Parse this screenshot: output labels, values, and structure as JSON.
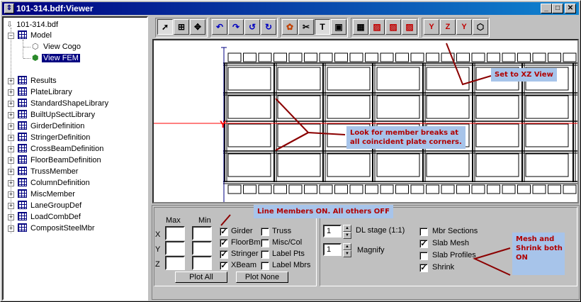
{
  "window": {
    "title": "101-314.bdf:Viewer",
    "controls": {
      "minimize": "_",
      "maximize": "□",
      "close": "✕"
    }
  },
  "tree": {
    "root": "101-314.bdf",
    "model": "Model",
    "model_children": [
      "View Cogo",
      "View FEM"
    ],
    "selected": "View FEM",
    "items": [
      "Results",
      "PlateLibrary",
      "StandardShapeLibrary",
      "BuiltUpSectLibrary",
      "GirderDefinition",
      "StringerDefinition",
      "CrossBeamDefinition",
      "FloorBeamDefinition",
      "TrussMember",
      "ColumnDefinition",
      "MiscMember",
      "LaneGroupDef",
      "LoadCombDef",
      "CompositSteelMbr"
    ]
  },
  "toolbar": {
    "groups": [
      [
        "pointer-tool",
        "zoom-window-tool",
        "pan-tool"
      ],
      [
        "rotate-x-tool",
        "rotate-y-tool",
        "rotate-z-tool",
        "rotate-free-tool"
      ],
      [
        "color-tool",
        "pin-tool",
        "text-tool",
        "render-tool"
      ],
      [
        "grid-tool",
        "view-xy-tool",
        "view-yz-tool",
        "view-xz-tool"
      ],
      [
        "axis-yx-tool",
        "axis-zx-tool",
        "axis-yz-tool",
        "iso-tool"
      ]
    ],
    "text_tool_label": "T",
    "axis_labels": [
      "Y",
      "Z",
      "Y"
    ]
  },
  "canvas": {
    "axis_label": "Y",
    "callouts": {
      "xz_view": "Set to XZ View",
      "member_breaks": "Look for member breaks at\nall coincident plate corners."
    }
  },
  "panel": {
    "range": {
      "max_label": "Max",
      "min_label": "Min",
      "axes": [
        "X",
        "Y",
        "Z"
      ]
    },
    "members": [
      {
        "label": "Girder",
        "checked": true
      },
      {
        "label": "FloorBm",
        "checked": true
      },
      {
        "label": "Stringer",
        "checked": true
      },
      {
        "label": "XBeam",
        "checked": true
      },
      {
        "label": "Truss",
        "checked": false
      },
      {
        "label": "Misc/Col",
        "checked": false
      },
      {
        "label": "Label Pts",
        "checked": false
      },
      {
        "label": "Label Mbrs",
        "checked": false
      }
    ],
    "plot_all": "Plot All",
    "plot_none": "Plot None",
    "dl_stage_value": "1",
    "dl_stage_label": "DL stage  (1:1)",
    "magnify_value": "1",
    "magnify_label": "Magnify",
    "options": [
      {
        "label": "Mbr Sections",
        "checked": false
      },
      {
        "label": "Slab Mesh",
        "checked": true
      },
      {
        "label": "Slab Profiles",
        "checked": false
      },
      {
        "label": "Shrink",
        "checked": true
      }
    ],
    "callouts": {
      "line_members": "Line Members ON.  All others OFF",
      "mesh_shrink": "Mesh and\nShrink both\nON"
    }
  },
  "colors": {
    "title_bar": "#000080",
    "callout_bg": "#a7c4ea",
    "callout_text": "#b00000",
    "arrow": "#8b0000",
    "axis_red": "#ff0000",
    "axis_blue": "#000080"
  }
}
